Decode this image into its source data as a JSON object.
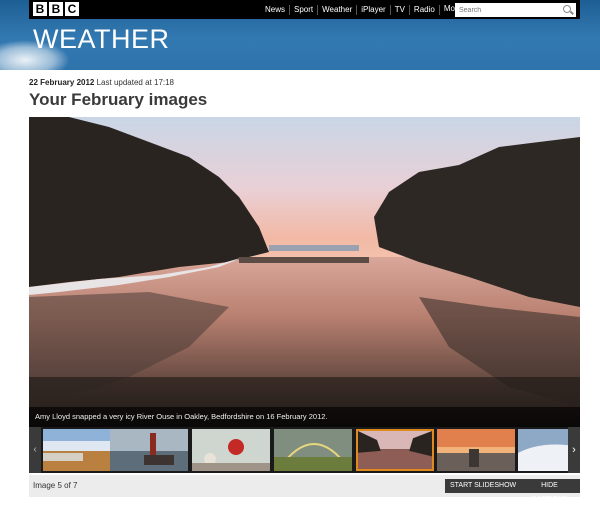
{
  "header": {
    "logo_letters": [
      "B",
      "B",
      "C"
    ],
    "nav": [
      {
        "label": "News"
      },
      {
        "label": "Sport"
      },
      {
        "label": "Weather"
      },
      {
        "label": "iPlayer"
      },
      {
        "label": "TV"
      },
      {
        "label": "Radio"
      },
      {
        "label": "More"
      }
    ],
    "search_placeholder": "Search",
    "section_title": "WEATHER"
  },
  "article": {
    "date": "22 February 2012",
    "updated": "Last updated at 17:18",
    "heading": "Your February images"
  },
  "gallery": {
    "caption": "Amy Lloyd snapped a very icy River Ouse in Oakley, Bedfordshire on 16 February 2012.",
    "counter": "Image 5 of 7",
    "start_slideshow": "START SLIDESHOW",
    "hide_captions": "HIDE CAPTIONS",
    "prev_icon": "chevron-left-icon",
    "next_icon": "chevron-right-icon",
    "active_thumb_color": "#e08a1e"
  },
  "colors": {
    "masthead": "#2f73ac",
    "topbar": "#000000",
    "button": "#3a3a3a"
  }
}
